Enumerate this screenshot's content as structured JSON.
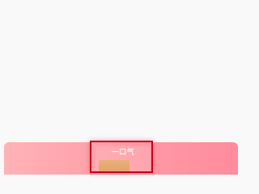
{
  "banner": {
    "tile": {
      "label": "一口气"
    }
  },
  "colors": {
    "background": "#f9f9f9",
    "banner_start": "#ffb3b6",
    "banner_end": "#ff8b9c",
    "highlight": "#c8001e",
    "thumbnail": "#e3a268"
  }
}
